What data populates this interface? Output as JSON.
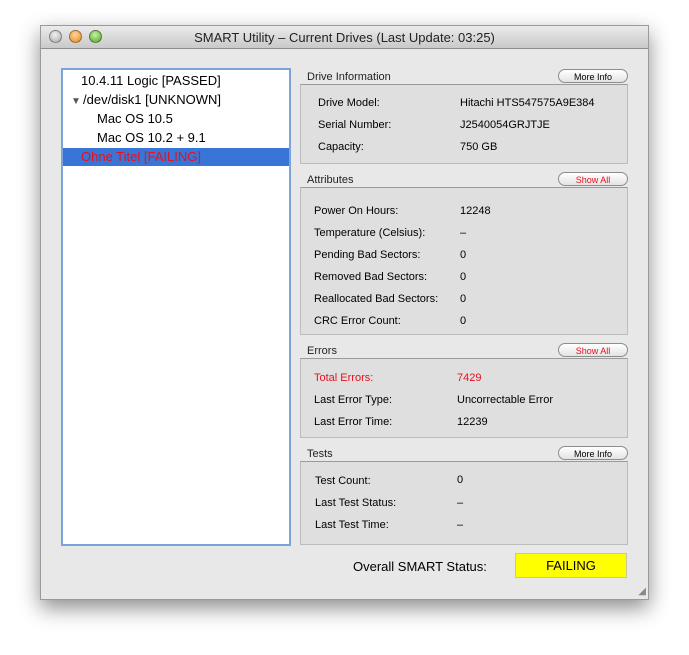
{
  "window": {
    "title": "SMART Utility – Current Drives (Last Update: 03:25)"
  },
  "tree": {
    "items": [
      {
        "label": "10.4.11 Logic  [PASSED]"
      },
      {
        "label": "/dev/disk1  [UNKNOWN]",
        "expanded": true
      },
      {
        "label": "Mac OS 10.5"
      },
      {
        "label": "Mac OS 10.2 + 9.1"
      },
      {
        "label": "Ohne Titel  [FAILING]",
        "selected": true,
        "status_color": "#e8101c"
      }
    ]
  },
  "drive_info": {
    "title": "Drive Information",
    "button": "More Info",
    "rows": [
      {
        "label": "Drive Model:",
        "value": "Hitachi HTS547575A9E384"
      },
      {
        "label": "Serial Number:",
        "value": "J2540054GRJTJE"
      },
      {
        "label": "Capacity:",
        "value": "750 GB"
      }
    ]
  },
  "attributes": {
    "title": "Attributes",
    "button": "Show All",
    "rows": [
      {
        "label": "Power On Hours:",
        "value": "12248"
      },
      {
        "label": "Temperature (Celsius):",
        "value": "–"
      },
      {
        "label": "Pending Bad Sectors:",
        "value": "0"
      },
      {
        "label": "Removed Bad Sectors:",
        "value": "0"
      },
      {
        "label": "Reallocated Bad Sectors:",
        "value": "0"
      },
      {
        "label": "CRC Error Count:",
        "value": "0"
      }
    ]
  },
  "errors": {
    "title": "Errors",
    "button": "Show All",
    "rows": [
      {
        "label": "Total Errors:",
        "value": "7429",
        "highlight": true
      },
      {
        "label": "Last Error Type:",
        "value": "Uncorrectable Error"
      },
      {
        "label": "Last Error Time:",
        "value": "12239"
      }
    ]
  },
  "tests": {
    "title": "Tests",
    "button": "More Info",
    "rows": [
      {
        "label": "Test Count:",
        "value": "0"
      },
      {
        "label": "Last Test Status:",
        "value": "–"
      },
      {
        "label": "Last Test Time:",
        "value": "–"
      }
    ]
  },
  "overall": {
    "label": "Overall SMART Status:",
    "value": "FAILING",
    "value_bg": "#ffff00"
  },
  "colors": {
    "failing": "#e8101c",
    "selection": "#3875d7"
  }
}
